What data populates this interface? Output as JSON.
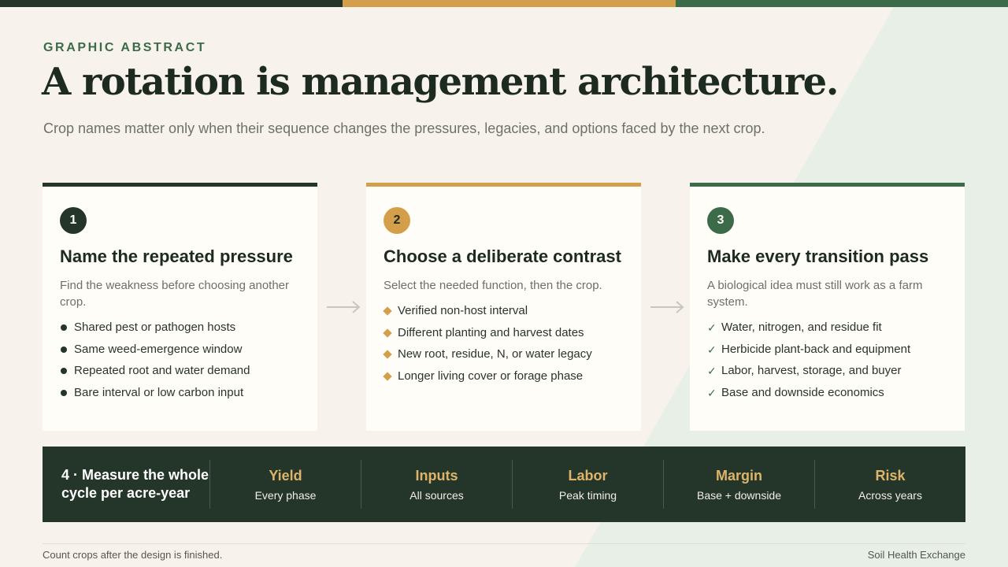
{
  "colors": {
    "dark_green": "#24352a",
    "gold": "#d39f4b",
    "green": "#3c6b49",
    "background": "#f7f3ec"
  },
  "kicker": "GRAPHIC ABSTRACT",
  "title": "A rotation is management architecture.",
  "subtitle": "Crop names matter only when their sequence changes the pressures, legacies, and options faced by the next crop.",
  "cards": [
    {
      "number": "1",
      "heading": "Name the repeated pressure",
      "description": "Find the weakness before choosing another crop.",
      "marker": "dot",
      "items": [
        "Shared pest or pathogen hosts",
        "Same weed-emergence window",
        "Repeated root and water demand",
        "Bare interval or low carbon input"
      ]
    },
    {
      "number": "2",
      "heading": "Choose a deliberate contrast",
      "description": "Select the needed function, then the crop.",
      "marker": "diamond",
      "items": [
        "Verified non-host interval",
        "Different planting and harvest dates",
        "New root, residue, N, or water legacy",
        "Longer living cover or forage phase"
      ]
    },
    {
      "number": "3",
      "heading": "Make every transition pass",
      "description": "A biological idea must still work as a farm system.",
      "marker": "check",
      "items": [
        "Water, nitrogen, and residue fit",
        "Herbicide plant-back and equipment",
        "Labor, harvest, storage, and buyer",
        "Base and downside economics"
      ]
    }
  ],
  "band": {
    "title": "4 · Measure the whole cycle per acre-year",
    "metrics": [
      {
        "name": "Yield",
        "sub": "Every phase"
      },
      {
        "name": "Inputs",
        "sub": "All sources"
      },
      {
        "name": "Labor",
        "sub": "Peak timing"
      },
      {
        "name": "Margin",
        "sub": "Base + downside"
      },
      {
        "name": "Risk",
        "sub": "Across years"
      }
    ]
  },
  "footer": {
    "left": "Count crops after the design is finished.",
    "right": "Soil Health Exchange"
  },
  "icons": {
    "arrow": "arrow-right-icon",
    "check": "check-icon"
  }
}
